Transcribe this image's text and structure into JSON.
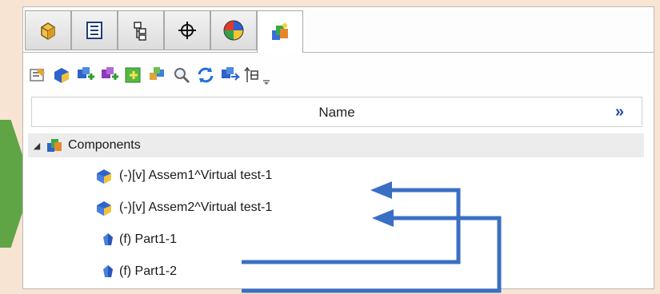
{
  "tree_panel": {
    "tabs": [
      {
        "name": "feature-manager-tab",
        "icon": "part-cube-icon"
      },
      {
        "name": "property-manager-tab",
        "icon": "property-list-icon"
      },
      {
        "name": "configuration-manager-tab",
        "icon": "configuration-icon"
      },
      {
        "name": "dimxpert-manager-tab",
        "icon": "crosshair-icon"
      },
      {
        "name": "display-manager-tab",
        "icon": "appearance-sphere-icon"
      },
      {
        "name": "assembly-components-tab",
        "icon": "assembly-components-icon",
        "active": true
      }
    ],
    "toolbar": [
      "properties-icon",
      "component-icon",
      "add-component-icon",
      "remove-component-icon",
      "insert-component-icon",
      "group-components-icon",
      "zoom-search-icon",
      "refresh-icon",
      "move-component-icon",
      "sort-icon",
      "overflow-icon"
    ],
    "header": {
      "name_label": "Name",
      "expand_label": "»"
    },
    "root": {
      "label": "Components"
    },
    "items": [
      {
        "label": "(-)[v] Assem1^Virtual test-1",
        "icon": "assembly-icon"
      },
      {
        "label": "(-)[v] Assem2^Virtual test-1",
        "icon": "assembly-icon"
      },
      {
        "label": "(f) Part1-1",
        "icon": "part-icon"
      },
      {
        "label": "(f) Part1-2",
        "icon": "part-icon"
      }
    ]
  },
  "annotations": {
    "arrow_color": "#3a6fc4"
  },
  "colors": {
    "accent_green": "#5fa546",
    "background": "#f8e4d2"
  }
}
